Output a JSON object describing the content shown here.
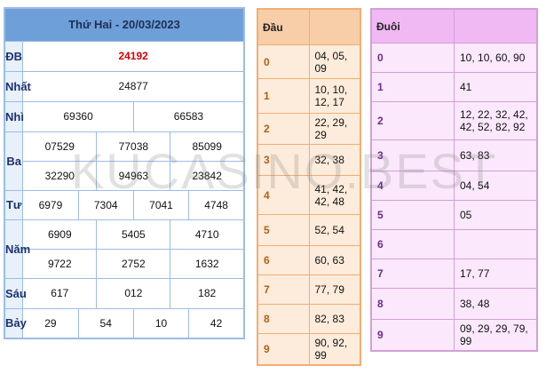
{
  "main": {
    "header": "Thứ Hai - 20/03/2023",
    "rows": [
      {
        "label": "ĐB",
        "values": [
          "24192"
        ]
      },
      {
        "label": "Nhất",
        "values": [
          "24877"
        ]
      },
      {
        "label": "Nhì",
        "values": [
          "69360",
          "66583"
        ]
      },
      {
        "label": "Ba",
        "values": [
          "07529",
          "77038",
          "85099",
          "32290",
          "94963",
          "23842"
        ]
      },
      {
        "label": "Tư",
        "values": [
          "6979",
          "7304",
          "7041",
          "4748"
        ]
      },
      {
        "label": "Năm",
        "values": [
          "6909",
          "5405",
          "4710",
          "9722",
          "2752",
          "1632"
        ]
      },
      {
        "label": "Sáu",
        "values": [
          "617",
          "012",
          "182"
        ]
      },
      {
        "label": "Bảy",
        "values": [
          "29",
          "54",
          "10",
          "42"
        ]
      }
    ]
  },
  "dau": {
    "header": "Đầu",
    "rows": [
      {
        "key": "0",
        "value": "04, 05, 09"
      },
      {
        "key": "1",
        "value": "10, 10, 12, 17"
      },
      {
        "key": "2",
        "value": "22, 29, 29"
      },
      {
        "key": "3",
        "value": "32, 38"
      },
      {
        "key": "4",
        "value": "41, 42, 42, 48"
      },
      {
        "key": "5",
        "value": "52, 54"
      },
      {
        "key": "6",
        "value": "60, 63"
      },
      {
        "key": "7",
        "value": "77, 79"
      },
      {
        "key": "8",
        "value": "82, 83"
      },
      {
        "key": "9",
        "value": "90, 92, 99"
      }
    ]
  },
  "duoi": {
    "header": "Đuôi",
    "rows": [
      {
        "key": "0",
        "value": "10, 10, 60, 90"
      },
      {
        "key": "1",
        "value": "41"
      },
      {
        "key": "2",
        "value": "12, 22, 32, 42, 42, 52, 82, 92"
      },
      {
        "key": "3",
        "value": "63, 83"
      },
      {
        "key": "4",
        "value": "04, 54"
      },
      {
        "key": "5",
        "value": "05"
      },
      {
        "key": "6",
        "value": ""
      },
      {
        "key": "7",
        "value": "17, 77"
      },
      {
        "key": "8",
        "value": "38, 48"
      },
      {
        "key": "9",
        "value": "09, 29, 29, 79, 99"
      }
    ]
  },
  "watermark": "KUCASINO.BEST"
}
